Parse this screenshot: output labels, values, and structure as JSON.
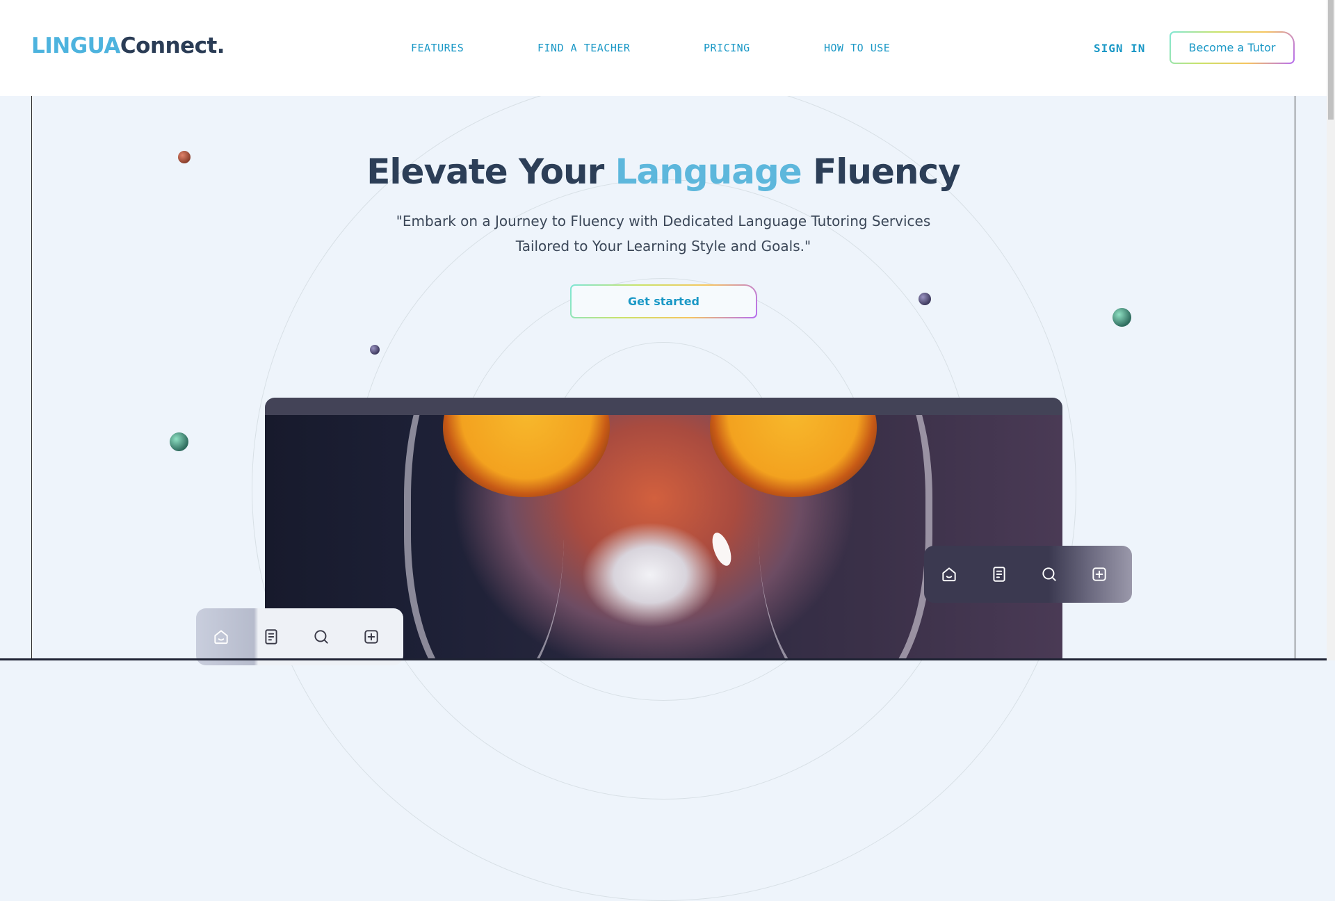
{
  "brand": {
    "part1": "LINGUA",
    "part2": "Connect."
  },
  "nav": {
    "features": "FEATURES",
    "find_teacher": "FIND A TEACHER",
    "pricing": "PRICING",
    "how_to_use": "HOW TO USE"
  },
  "header": {
    "sign_in": "SIGN IN",
    "become_tutor": "Become a Tutor"
  },
  "hero": {
    "title_pre": "Elevate Your ",
    "title_highlight": "Language",
    "title_post": " Fluency",
    "subtitle": "\"Embark on a Journey to Fluency with Dedicated Language Tutoring Services Tailored to Your Learning Style and Goals.\"",
    "cta": "Get started"
  },
  "toolbars": {
    "icons": [
      "home-icon",
      "document-icon",
      "search-icon",
      "add-icon"
    ]
  },
  "colors": {
    "accent": "#1a98c6",
    "highlight": "#5db7dc",
    "dark_text": "#2c3e57",
    "background": "#eef4fb"
  }
}
